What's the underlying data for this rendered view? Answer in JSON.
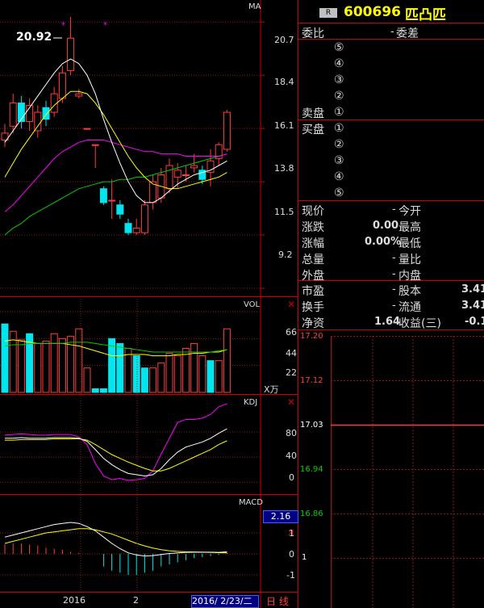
{
  "colors": {
    "up": "#ff3d3d",
    "down": "#00e5ee",
    "grid": "#8b1a1a",
    "border": "#cc0000",
    "yellow": "#ffff00",
    "magenta": "#ff00ff",
    "green": "#00cc00",
    "white": "#ffffff"
  },
  "main_chart": {
    "label": "MA",
    "high_label": "20.92",
    "y_ticks": [
      "20.7",
      "18.4",
      "16.1",
      "13.8",
      "11.5",
      "9.2"
    ]
  },
  "vol_chart": {
    "label": "VOL",
    "y_ticks": [
      "66",
      "44",
      "22"
    ],
    "unit": "X万"
  },
  "kdj_chart": {
    "label": "KDJ",
    "y_ticks": [
      "80",
      "40",
      "0"
    ]
  },
  "macd_chart": {
    "label": "MACD",
    "value_box": "2.16",
    "y_ticks": [
      "1",
      "0",
      "-1"
    ]
  },
  "x_axis": {
    "label_left": "2016",
    "label_mid": "2",
    "date_box": "2016/ 2/23/二",
    "period": "日 线"
  },
  "quote": {
    "badge": "R",
    "code": "600696",
    "name": "匹凸匹",
    "weibi_label": "委比",
    "weibi_value": "-",
    "weicha_label": "委差",
    "sell_label": "卖盘",
    "buy_label": "买盘",
    "sell_levels": [
      "⑤",
      "④",
      "③",
      "②",
      "①"
    ],
    "buy_levels": [
      "①",
      "②",
      "③",
      "④",
      "⑤"
    ],
    "rows1": [
      {
        "l1": "现价",
        "v1": "-",
        "l2": "今开",
        "v2": ""
      },
      {
        "l1": "涨跌",
        "v1": "0.00",
        "l2": "最高",
        "v2": ""
      },
      {
        "l1": "涨幅",
        "v1": "0.00%",
        "l2": "最低",
        "v2": ""
      },
      {
        "l1": "总量",
        "v1": "-",
        "l2": "量比",
        "v2": ""
      },
      {
        "l1": "外盘",
        "v1": "-",
        "l2": "内盘",
        "v2": ""
      }
    ],
    "rows2": [
      {
        "l1": "市盈",
        "v1": "-",
        "l2": "股本",
        "v2": "3.41"
      },
      {
        "l1": "换手",
        "v1": "-",
        "l2": "流通",
        "v2": "3.41"
      },
      {
        "l1": "净资",
        "v1": "1.64",
        "l2": "收益(三)",
        "v2": "-0.1"
      }
    ]
  },
  "intraday": {
    "y_ticks": [
      "17.20",
      "17.12",
      "17.03",
      "16.94",
      "16.86"
    ],
    "y_tick_colors": [
      "#ff3d3d",
      "#ff3d3d",
      "#ffffff",
      "#00cc00",
      "#00cc00"
    ],
    "extra_tick": "1"
  },
  "chart_data": {
    "type": "candlestick",
    "ylim": [
      9.2,
      20.92
    ],
    "candles": [
      {
        "o": 15.6,
        "c": 15.9,
        "h": 16.3,
        "l": 15.3
      },
      {
        "o": 16.2,
        "c": 17.2,
        "h": 17.6,
        "l": 15.9
      },
      {
        "o": 17.2,
        "c": 16.4,
        "h": 17.5,
        "l": 16.1
      },
      {
        "o": 16.4,
        "c": 17.1,
        "h": 17.4,
        "l": 16.0
      },
      {
        "o": 16.0,
        "c": 16.8,
        "h": 17.1,
        "l": 15.7
      },
      {
        "o": 17.0,
        "c": 16.5,
        "h": 17.3,
        "l": 16.2
      },
      {
        "o": 16.8,
        "c": 17.6,
        "h": 17.9,
        "l": 16.6
      },
      {
        "o": 17.4,
        "c": 18.5,
        "h": 18.8,
        "l": 17.2
      },
      {
        "o": 18.6,
        "c": 20.0,
        "h": 20.92,
        "l": 18.4
      },
      {
        "o": 17.5,
        "c": 17.6,
        "h": 17.8,
        "l": 17.4
      },
      {
        "o": 16.1,
        "c": 16.1,
        "h": 16.1,
        "l": 16.1
      },
      {
        "o": 15.4,
        "c": 15.4,
        "h": 15.4,
        "l": 14.4
      },
      {
        "o": 13.5,
        "c": 12.9,
        "h": 13.6,
        "l": 12.8
      },
      {
        "o": 13.0,
        "c": 13.0,
        "h": 13.9,
        "l": 12.2
      },
      {
        "o": 12.8,
        "c": 12.4,
        "h": 13.0,
        "l": 12.2
      },
      {
        "o": 12.0,
        "c": 11.6,
        "h": 12.2,
        "l": 11.5
      },
      {
        "o": 11.6,
        "c": 11.8,
        "h": 12.2,
        "l": 11.5
      },
      {
        "o": 11.6,
        "c": 12.8,
        "h": 13.0,
        "l": 11.5
      },
      {
        "o": 12.9,
        "c": 13.8,
        "h": 14.1,
        "l": 12.6
      },
      {
        "o": 13.1,
        "c": 14.1,
        "h": 14.4,
        "l": 12.9
      },
      {
        "o": 13.5,
        "c": 14.5,
        "h": 14.8,
        "l": 13.3
      },
      {
        "o": 14.0,
        "c": 14.3,
        "h": 14.6,
        "l": 13.5
      },
      {
        "o": 14.1,
        "c": 14.1,
        "h": 14.5,
        "l": 13.8
      },
      {
        "o": 14.4,
        "c": 14.5,
        "h": 15.0,
        "l": 14.2
      },
      {
        "o": 14.3,
        "c": 13.9,
        "h": 14.5,
        "l": 13.7
      },
      {
        "o": 14.2,
        "c": 14.7,
        "h": 15.2,
        "l": 13.6
      },
      {
        "o": 14.8,
        "c": 15.4,
        "h": 15.5,
        "l": 14.5
      },
      {
        "o": 15.2,
        "c": 16.8,
        "h": 16.9,
        "l": 15.1
      }
    ],
    "ma_white": [
      15.5,
      16.0,
      16.5,
      17.0,
      17.5,
      18.0,
      18.5,
      18.9,
      19.1,
      18.9,
      18.4,
      17.6,
      16.5,
      15.5,
      14.6,
      13.8,
      13.2,
      12.9,
      12.9,
      13.1,
      13.4,
      13.7,
      13.9,
      14.1,
      14.2,
      14.3,
      14.5,
      14.7
    ],
    "ma_yellow": [
      14.0,
      14.6,
      15.2,
      15.7,
      16.2,
      16.7,
      17.1,
      17.4,
      17.7,
      17.7,
      17.6,
      17.2,
      16.7,
      16.1,
      15.5,
      14.9,
      14.4,
      14.0,
      13.7,
      13.6,
      13.5,
      13.5,
      13.6,
      13.7,
      13.8,
      13.9,
      14.0,
      14.2
    ],
    "ma_magenta": [
      12.5,
      12.8,
      13.2,
      13.6,
      14.0,
      14.4,
      14.8,
      15.1,
      15.3,
      15.5,
      15.6,
      15.6,
      15.6,
      15.5,
      15.4,
      15.3,
      15.2,
      15.1,
      15.1,
      15.0,
      15.0,
      15.0,
      14.9,
      14.9,
      14.9,
      14.9,
      14.9,
      15.0
    ],
    "ma_green": [
      11.5,
      11.8,
      12.0,
      12.3,
      12.5,
      12.7,
      12.9,
      13.1,
      13.3,
      13.5,
      13.6,
      13.7,
      13.8,
      13.8,
      13.9,
      13.9,
      14.0,
      14.0,
      14.1,
      14.2,
      14.3,
      14.4,
      14.5,
      14.6,
      14.7,
      14.8,
      14.9,
      15.0
    ],
    "volume": [
      56,
      50,
      43,
      48,
      40,
      42,
      48,
      44,
      46,
      52,
      20,
      3,
      3,
      44,
      40,
      36,
      30,
      20,
      20,
      24,
      32,
      30,
      36,
      40,
      30,
      26,
      26,
      52
    ],
    "vol_down": [
      true,
      false,
      false,
      true,
      false,
      false,
      false,
      false,
      false,
      false,
      false,
      true,
      true,
      true,
      true,
      false,
      true,
      true,
      false,
      false,
      false,
      false,
      false,
      false,
      false,
      true,
      false,
      false
    ],
    "vol_ma": [
      42,
      43,
      42,
      41,
      40,
      40,
      40,
      40,
      39,
      38,
      36,
      34,
      32,
      30,
      30,
      31,
      31,
      31,
      30,
      30,
      30,
      31,
      31,
      32,
      32,
      33,
      33,
      35
    ],
    "vol_ma2": [
      38,
      39,
      39,
      40,
      40,
      40,
      40,
      40,
      41,
      41,
      41,
      40,
      39,
      38,
      37,
      36,
      35,
      34,
      33,
      33,
      33,
      33,
      33,
      33,
      33,
      33,
      34,
      35
    ],
    "kdj_j": [
      75,
      76,
      77,
      76,
      75,
      75,
      76,
      76,
      76,
      72,
      60,
      30,
      10,
      4,
      6,
      3,
      4,
      6,
      18,
      45,
      70,
      95,
      100,
      100,
      102,
      108,
      120,
      125
    ],
    "kdj_k": [
      70,
      70,
      71,
      70,
      70,
      70,
      71,
      71,
      71,
      70,
      65,
      52,
      38,
      28,
      20,
      14,
      12,
      10,
      12,
      22,
      36,
      48,
      56,
      60,
      64,
      70,
      78,
      85
    ],
    "kdj_d": [
      67,
      67,
      68,
      68,
      68,
      68,
      69,
      69,
      69,
      69,
      67,
      60,
      52,
      44,
      38,
      32,
      27,
      22,
      18,
      18,
      22,
      28,
      34,
      40,
      46,
      52,
      60,
      66
    ],
    "macd_hist": [
      0.45,
      0.5,
      0.5,
      0.45,
      0.4,
      0.3,
      0.25,
      0.2,
      0.1,
      0.05,
      0,
      0.0,
      -0.6,
      -0.8,
      -0.9,
      -1.0,
      -1.0,
      -0.9,
      -0.8,
      -0.6,
      -0.5,
      -0.4,
      -0.3,
      -0.2,
      -0.15,
      -0.1,
      -0.05,
      0.05
    ],
    "macd_dif": [
      0.8,
      0.9,
      1.0,
      1.1,
      1.2,
      1.3,
      1.4,
      1.45,
      1.5,
      1.45,
      1.3,
      1.1,
      0.8,
      0.5,
      0.25,
      0.05,
      -0.05,
      -0.1,
      -0.08,
      -0.03,
      0.02,
      0.05,
      0.07,
      0.08,
      0.08,
      0.08,
      0.07,
      0.1
    ],
    "macd_dea": [
      0.5,
      0.6,
      0.7,
      0.8,
      0.9,
      1.0,
      1.05,
      1.1,
      1.15,
      1.2,
      1.2,
      1.15,
      1.05,
      0.95,
      0.8,
      0.65,
      0.5,
      0.38,
      0.28,
      0.2,
      0.15,
      0.12,
      0.1,
      0.09,
      0.08,
      0.07,
      0.06,
      0.05
    ]
  }
}
